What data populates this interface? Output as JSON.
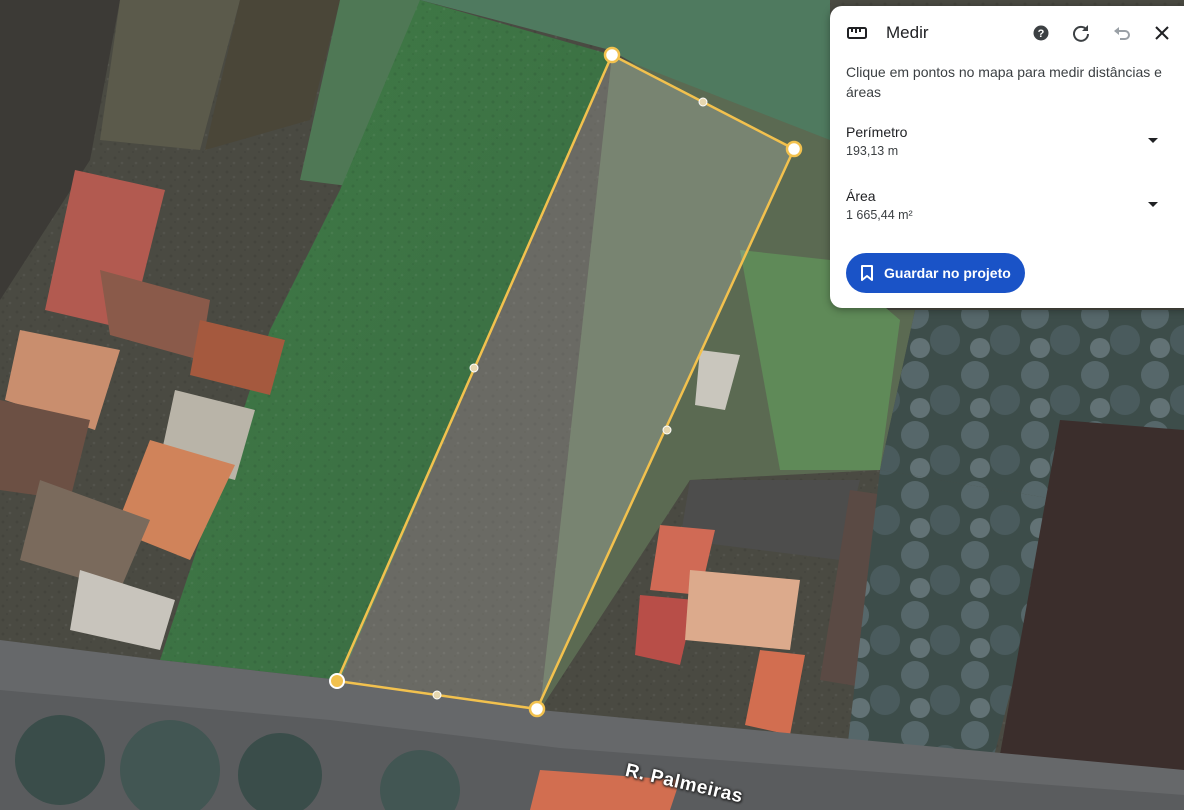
{
  "map": {
    "street_label": "R. Palmeiras"
  },
  "panel": {
    "title": "Medir",
    "instructions": "Clique em pontos no mapa para medir distâncias e áreas",
    "perimeter": {
      "label": "Perímetro",
      "value": "193,13 m"
    },
    "area": {
      "label": "Área",
      "value": "1 665,44 m²"
    },
    "save_label": "Guardar no projeto"
  },
  "icons": {
    "header": [
      "ruler-icon",
      "help-icon",
      "refresh-icon",
      "undo-icon",
      "close-icon"
    ],
    "save": "bookmark-icon"
  },
  "colors": {
    "measure_line": "#f2c14e",
    "save_button": "#1a53c7",
    "undo_disabled": "#9aa0a6"
  }
}
